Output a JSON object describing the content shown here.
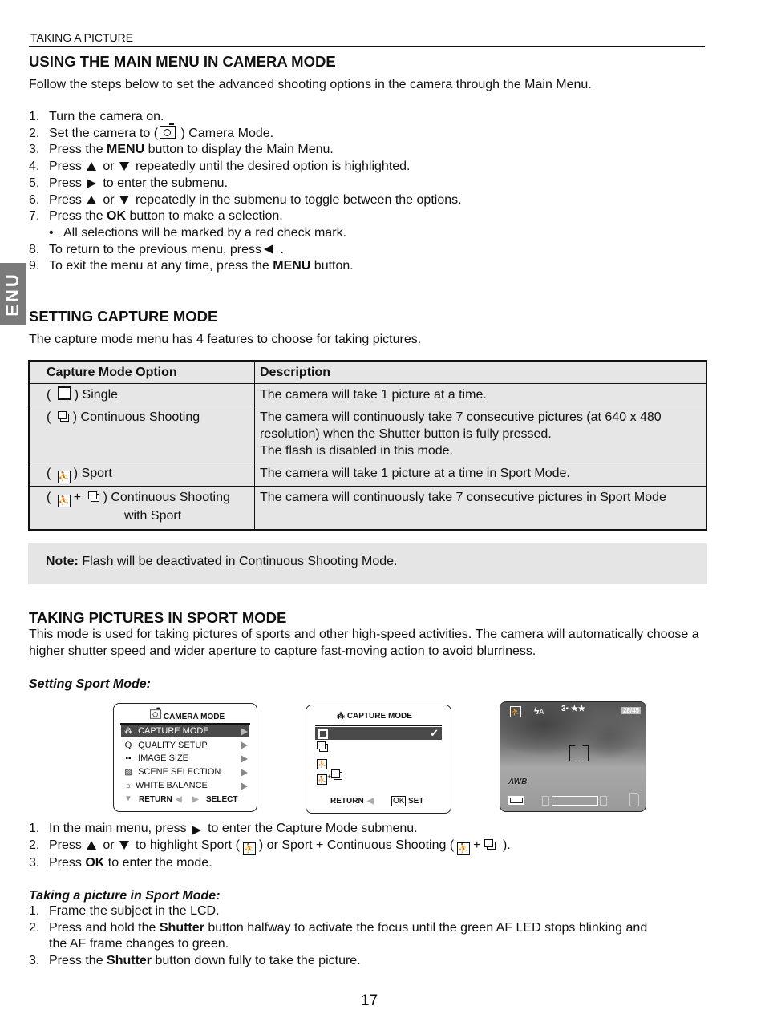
{
  "header": {
    "section": "TAKING A PICTURE"
  },
  "side_tab": "ENU",
  "main_menu": {
    "title": "USING THE MAIN MENU IN CAMERA MODE",
    "intro": "Follow the steps below to set the advanced shooting options in the camera through the Main Menu.",
    "steps": [
      {
        "n": "1.",
        "text": "Turn the camera on."
      },
      {
        "n": "2.",
        "pre": "Set the camera to (",
        "icon": "camera-icon",
        "post": ") Camera Mode."
      },
      {
        "n": "3.",
        "pre": "Press the ",
        "bold": "MENU",
        "post": " button to display the Main Menu."
      },
      {
        "n": "4.",
        "pre": "Press",
        "mid": "or",
        "post": "repeatedly until the desired option is highlighted."
      },
      {
        "n": "5.",
        "pre": "Press",
        "post": "to enter the submenu."
      },
      {
        "n": "6.",
        "pre": "Press",
        "mid": "or",
        "post": "repeatedly in the submenu to toggle between the options."
      },
      {
        "n": "7.",
        "pre": "Press the ",
        "bold": "OK",
        "post": " button to make a selection."
      },
      {
        "n": "•",
        "text": "All selections will be marked by a red check mark."
      },
      {
        "n": "8.",
        "pre": "To return to the previous menu, press",
        "post": "."
      },
      {
        "n": "9.",
        "pre": "To exit the menu at any time, press the ",
        "bold": "MENU",
        "post": " button."
      }
    ]
  },
  "capture_mode": {
    "title": "SETTING CAPTURE MODE",
    "intro": "The capture mode menu has 4 features to choose for taking pictures.",
    "table": {
      "headers": [
        "Capture Mode Option",
        "Description"
      ],
      "rows": [
        {
          "option": ") Single",
          "icons": [
            "single-shot-icon"
          ],
          "description": "The camera will take 1 picture at a time."
        },
        {
          "option": ") Continuous Shooting",
          "icons": [
            "continuous-shot-icon"
          ],
          "description": [
            "The camera will continuously take 7 consecutive pictures (at 640 x 480",
            "resolution) when the Shutter button is fully pressed.",
            "The flash is disabled in this mode."
          ]
        },
        {
          "option": ") Sport",
          "icons": [
            "sport-icon"
          ],
          "description": "The camera will take 1 picture at a time in Sport Mode."
        },
        {
          "option": ") Continuous Shooting",
          "option_line2": "with Sport",
          "icons": [
            "sport-icon",
            "continuous-shot-icon"
          ],
          "description": "The camera will continuously take 7 consecutive pictures in Sport Mode"
        }
      ]
    },
    "note_label": "Note:",
    "note_text": " Flash will be deactivated in Continuous Shooting Mode."
  },
  "sport_mode": {
    "title": "TAKING PICTURES IN SPORT MODE",
    "intro": "This mode is used for taking pictures of sports and other high-speed activities. The camera will automatically choose a higher shutter speed and wider aperture to capture fast-moving action to avoid blurriness.",
    "setting_heading": "Setting Sport Mode:",
    "screens": {
      "camera_menu": {
        "title": "CAMERA MODE",
        "items": [
          "CAPTURE MODE",
          "QUALITY SETUP",
          "IMAGE SIZE",
          "SCENE SELECTION",
          "WHITE BALANCE"
        ],
        "selected_index": 0,
        "footer_left": "RETURN",
        "footer_right": "SELECT"
      },
      "capture_menu": {
        "title": "CAPTURE MODE",
        "selected_index": 0,
        "footer_left": "RETURN",
        "ok": "OK",
        "footer_right": "SET"
      },
      "preview": {
        "shots": "28/45",
        "flash": "A",
        "wb": "AWB"
      }
    },
    "setting_steps": [
      {
        "n": "1.",
        "pre": "In the main menu, press",
        "post": "to enter the Capture Mode submenu."
      },
      {
        "n": "2.",
        "pre": "Press",
        "mid": "or",
        "post1": "to highlight Sport (",
        "post2": ") or Sport + Continuous Shooting (",
        "plus": "+",
        "post3": ")."
      },
      {
        "n": "3.",
        "pre": "Press ",
        "bold": "OK",
        "post": " to enter the mode."
      }
    ],
    "taking_heading": "Taking a picture in Sport Mode:",
    "taking_steps": [
      {
        "n": "1.",
        "text": "Frame the subject in the LCD."
      },
      {
        "n": "2.",
        "pre": "Press and hold the ",
        "bold": "Shutter",
        "post": " button halfway to activate the focus until the green AF LED stops blinking and",
        "line2": "the AF frame changes to green."
      },
      {
        "n": "3.",
        "pre": "Press the ",
        "bold": "Shutter",
        "post": " button down fully to take the picture."
      }
    ]
  },
  "page_number": "17"
}
